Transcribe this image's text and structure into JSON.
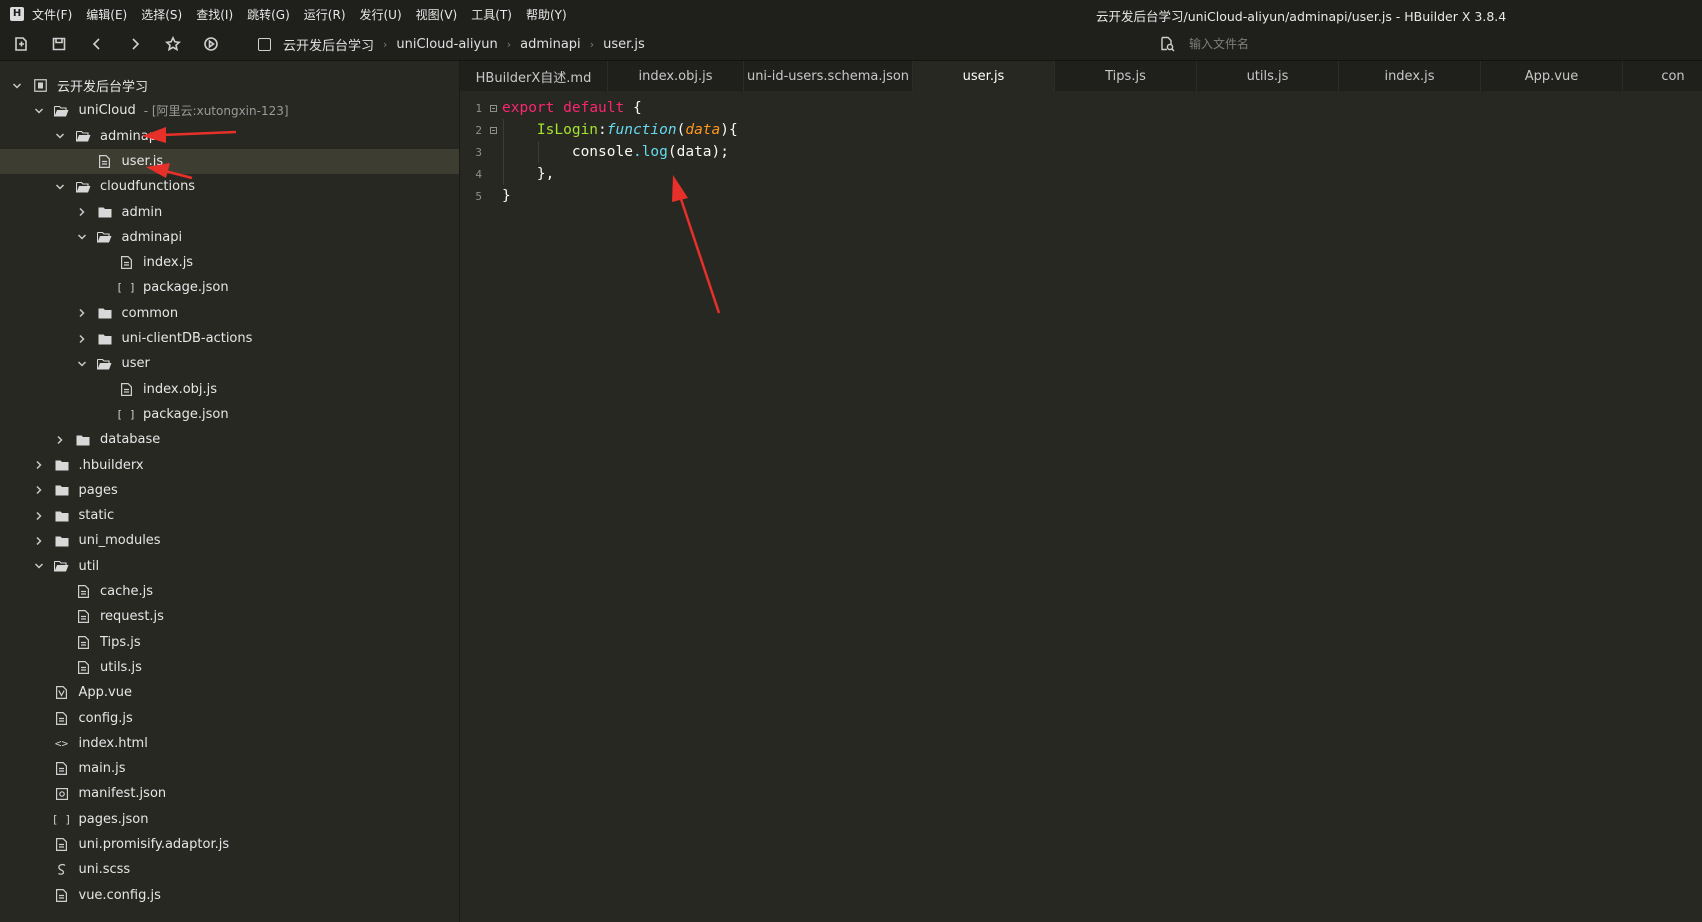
{
  "window": {
    "title": "云开发后台学习/uniCloud-aliyun/adminapi/user.js - HBuilder X 3.8.4"
  },
  "menu": [
    "文件(F)",
    "编辑(E)",
    "选择(S)",
    "查找(I)",
    "跳转(G)",
    "运行(R)",
    "发行(U)",
    "视图(V)",
    "工具(T)",
    "帮助(Y)"
  ],
  "breadcrumb": [
    "云开发后台学习",
    "uniCloud-aliyun",
    "adminapi",
    "user.js"
  ],
  "search": {
    "placeholder": "输入文件名"
  },
  "tree": [
    {
      "label": "云开发后台学习",
      "depth": 0,
      "icon": "project-icon",
      "state": "expanded"
    },
    {
      "label": "uniCloud",
      "sub": "- [阿里云:xutongxin-123]",
      "depth": 1,
      "icon": "cloud-folder-icon",
      "state": "expanded"
    },
    {
      "label": "adminapi",
      "depth": 2,
      "icon": "folder-open-icon",
      "state": "expanded"
    },
    {
      "label": "user.js",
      "depth": 3,
      "icon": "file-icon",
      "state": "leaf",
      "selected": true
    },
    {
      "label": "cloudfunctions",
      "depth": 2,
      "icon": "folder-open-icon",
      "state": "expanded"
    },
    {
      "label": "admin",
      "depth": 3,
      "icon": "folder-icon",
      "state": "collapsed"
    },
    {
      "label": "adminapi",
      "depth": 3,
      "icon": "folder-open-icon",
      "state": "expanded"
    },
    {
      "label": "index.js",
      "depth": 4,
      "icon": "file-icon",
      "state": "leaf"
    },
    {
      "label": "package.json",
      "depth": 4,
      "icon": "json-icon",
      "state": "leaf"
    },
    {
      "label": "common",
      "depth": 3,
      "icon": "folder-icon",
      "state": "collapsed"
    },
    {
      "label": "uni-clientDB-actions",
      "depth": 3,
      "icon": "folder-icon",
      "state": "collapsed"
    },
    {
      "label": "user",
      "depth": 3,
      "icon": "folder-open-icon",
      "state": "expanded"
    },
    {
      "label": "index.obj.js",
      "depth": 4,
      "icon": "file-icon",
      "state": "leaf"
    },
    {
      "label": "package.json",
      "depth": 4,
      "icon": "json-icon",
      "state": "leaf"
    },
    {
      "label": "database",
      "depth": 2,
      "icon": "folder-icon",
      "state": "collapsed"
    },
    {
      "label": ".hbuilderx",
      "depth": 1,
      "icon": "folder-icon",
      "state": "collapsed"
    },
    {
      "label": "pages",
      "depth": 1,
      "icon": "folder-icon",
      "state": "collapsed"
    },
    {
      "label": "static",
      "depth": 1,
      "icon": "folder-icon",
      "state": "collapsed"
    },
    {
      "label": "uni_modules",
      "depth": 1,
      "icon": "folder-icon",
      "state": "collapsed"
    },
    {
      "label": "util",
      "depth": 1,
      "icon": "folder-open-icon",
      "state": "expanded"
    },
    {
      "label": "cache.js",
      "depth": 2,
      "icon": "file-icon",
      "state": "leaf"
    },
    {
      "label": "request.js",
      "depth": 2,
      "icon": "file-icon",
      "state": "leaf"
    },
    {
      "label": "Tips.js",
      "depth": 2,
      "icon": "file-icon",
      "state": "leaf"
    },
    {
      "label": "utils.js",
      "depth": 2,
      "icon": "file-icon",
      "state": "leaf"
    },
    {
      "label": "App.vue",
      "depth": 1,
      "icon": "vue-file-icon",
      "state": "leaf"
    },
    {
      "label": "config.js",
      "depth": 1,
      "icon": "file-icon",
      "state": "leaf"
    },
    {
      "label": "index.html",
      "depth": 1,
      "icon": "html-icon",
      "state": "leaf"
    },
    {
      "label": "main.js",
      "depth": 1,
      "icon": "file-icon",
      "state": "leaf"
    },
    {
      "label": "manifest.json",
      "depth": 1,
      "icon": "manifest-icon",
      "state": "leaf"
    },
    {
      "label": "pages.json",
      "depth": 1,
      "icon": "json-icon",
      "state": "leaf"
    },
    {
      "label": "uni.promisify.adaptor.js",
      "depth": 1,
      "icon": "file-icon",
      "state": "leaf"
    },
    {
      "label": "uni.scss",
      "depth": 1,
      "icon": "scss-icon",
      "state": "leaf"
    },
    {
      "label": "vue.config.js",
      "depth": 1,
      "icon": "file-icon",
      "state": "leaf"
    }
  ],
  "tabs": [
    {
      "label": "HBuilderX自述.md"
    },
    {
      "label": "index.obj.js"
    },
    {
      "label": "uni-id-users.schema.json"
    },
    {
      "label": "user.js",
      "active": true
    },
    {
      "label": "Tips.js"
    },
    {
      "label": "utils.js"
    },
    {
      "label": "index.js"
    },
    {
      "label": "App.vue"
    },
    {
      "label": "con"
    }
  ],
  "editor": {
    "line_numbers": [
      "1",
      "2",
      "3",
      "4",
      "5"
    ],
    "code": {
      "l1_kw1": "export",
      "l1_kw2": "default",
      "l1_brace": " {",
      "l2_name": "IsLogin",
      "l2_colon": ":",
      "l2_func": "function",
      "l2_open": "(",
      "l2_param": "data",
      "l2_close": "){",
      "l3_obj": "console",
      "l3_dot": ".",
      "l3_meth": "log",
      "l3_args": "(data);",
      "l4": "},",
      "l5": "}"
    }
  },
  "colors": {
    "editor_bg": "#272822",
    "chrome_bg": "#1f201c",
    "keyword": "#f92672",
    "function_name": "#a6e22e",
    "storage": "#66d9ef",
    "parameter": "#fd971f",
    "annotation": "#e8302a"
  }
}
